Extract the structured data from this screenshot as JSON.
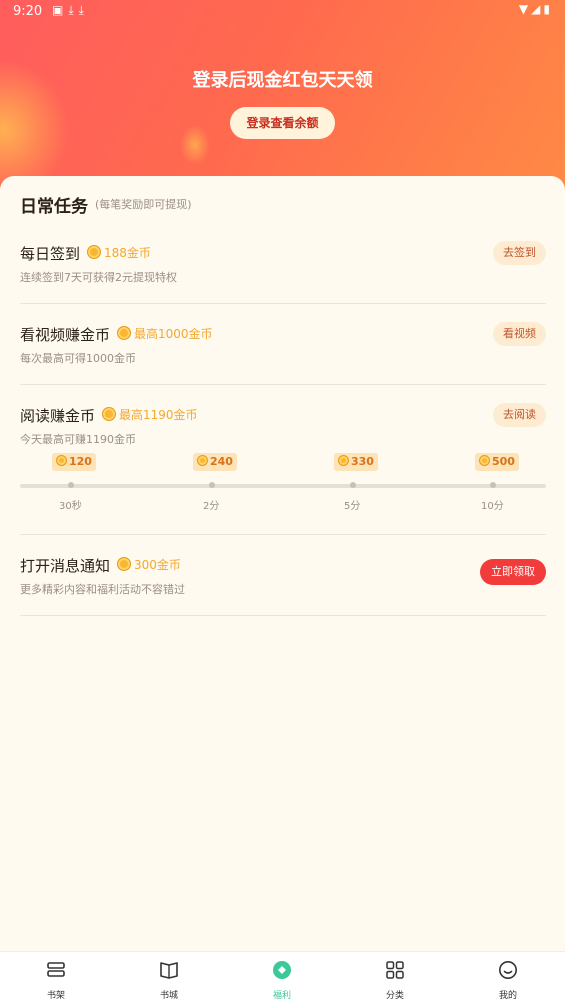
{
  "status_bar": {
    "time": "9:20"
  },
  "hero": {
    "title": "登录后现金红包天天领",
    "login_button": "登录查看余额"
  },
  "daily_tasks": {
    "title": "日常任务",
    "subtitle": "(每笔奖励即可提现)",
    "tasks": [
      {
        "name": "每日签到",
        "reward": "188金币",
        "desc": "连续签到7天可获得2元提现特权",
        "action": "去签到"
      },
      {
        "name": "看视频赚金币",
        "reward": "最高1000金币",
        "desc": "每次最高可得1000金币",
        "action": "看视频"
      },
      {
        "name": "阅读赚金币",
        "reward": "最高1190金币",
        "desc": "今天最高可赚1190金币",
        "action": "去阅读"
      },
      {
        "name": "打开消息通知",
        "reward": "300金币",
        "desc": "更多精彩内容和福利活动不容错过",
        "action": "立即领取"
      }
    ],
    "reading_milestones": [
      {
        "coins": "120",
        "time": "30秒"
      },
      {
        "coins": "240",
        "time": "2分"
      },
      {
        "coins": "330",
        "time": "5分"
      },
      {
        "coins": "500",
        "time": "10分"
      }
    ]
  },
  "tabbar": {
    "items": [
      {
        "label": "书架",
        "icon": "bookshelf-icon"
      },
      {
        "label": "书城",
        "icon": "book-icon"
      },
      {
        "label": "福利",
        "icon": "welfare-icon"
      },
      {
        "label": "分类",
        "icon": "grid-icon"
      },
      {
        "label": "我的",
        "icon": "profile-icon"
      }
    ],
    "active_index": 2
  },
  "colors": {
    "hero_start": "#ff5d5d",
    "hero_end": "#ff8a45",
    "accent_red": "#f23c3c",
    "coin": "#f3a832",
    "active_tab": "#3bc99a"
  }
}
